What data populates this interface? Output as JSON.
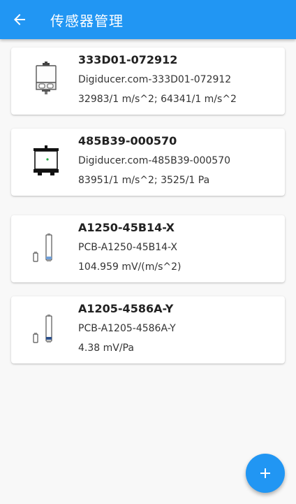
{
  "app_bar": {
    "title": "传感器管理",
    "back_icon": "arrow-back-icon",
    "background": "#2196f3"
  },
  "sensors": [
    {
      "title": "333D01-072912",
      "line1": "Digiducer.com-333D01-072912",
      "line2": "32983/1 m/s^2; 64341/1 m/s^2",
      "icon": "digiducer-white-icon"
    },
    {
      "title": "485B39-000570",
      "line1": "Digiducer.com-485B39-000570",
      "line2": "83951/1 m/s^2; 3525/1 Pa",
      "icon": "digiducer-black-icon"
    },
    {
      "title": "A1250-45B14-X",
      "line1": "PCB-A1250-45B14-X",
      "line2": "104.959 mV/(m/s^2)",
      "icon": "pcb-probe-icon"
    },
    {
      "title": "A1205-4586A-Y",
      "line1": "PCB-A1205-4586A-Y",
      "line2": "4.38 mV/Pa",
      "icon": "pcb-probe-icon"
    }
  ],
  "fab": {
    "icon": "plus-icon",
    "color": "#2196f3"
  }
}
